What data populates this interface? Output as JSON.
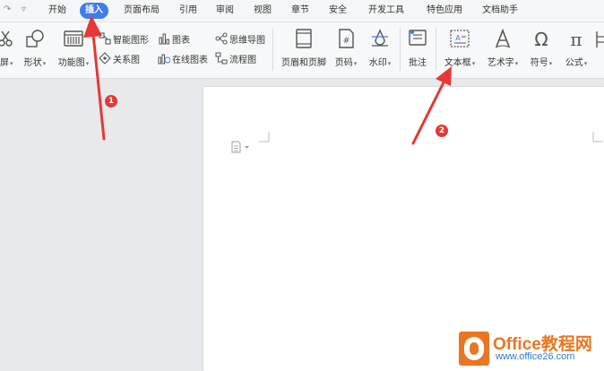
{
  "tabs": {
    "items": [
      "开始",
      "插入",
      "页面布局",
      "引用",
      "审阅",
      "视图",
      "章节",
      "安全",
      "开发工具",
      "特色应用",
      "文档助手"
    ],
    "active": "插入"
  },
  "ribbon": {
    "screen_label": "屏",
    "shape_label": "形状",
    "function_chart_label": "功能图",
    "smart_shape_label": "智能图形",
    "chart_label": "图表",
    "mindmap_label": "思维导图",
    "relation_label": "关系图",
    "online_chart_label": "在线图表",
    "flowchart_label": "流程图",
    "header_footer_label": "页眉和页脚",
    "page_number_label": "页码",
    "watermark_label": "水印",
    "comment_label": "批注",
    "textbox_label": "文本框",
    "wordart_label": "艺术字",
    "symbol_label": "符号",
    "formula_label": "公式",
    "dropdown_glyph": "▾"
  },
  "annotations": {
    "badge1": "1",
    "badge2": "2",
    "color": "#e53935"
  },
  "watermark": {
    "title": "Office教程网",
    "url": "www.office26.com"
  },
  "colors": {
    "accent": "#3f7cf0",
    "arrow": "#e53935",
    "watermark_orange": "#e87722",
    "watermark_blue": "#2b7bd2"
  }
}
